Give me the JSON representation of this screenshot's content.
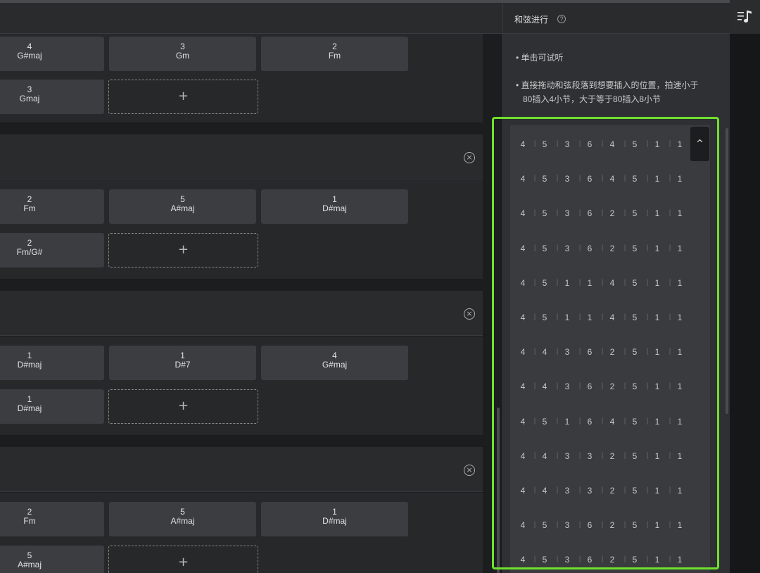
{
  "sections": [
    {
      "chords_row1": [
        {
          "degree": "4",
          "name": "G#maj"
        },
        {
          "degree": "3",
          "name": "Gm"
        },
        {
          "degree": "2",
          "name": "Fm"
        }
      ],
      "chords_row2": [
        {
          "degree": "3",
          "name": "Gmaj"
        }
      ],
      "add_label": "+"
    },
    {
      "close_symbol": "×",
      "chords_row1": [
        {
          "degree": "2",
          "name": "Fm"
        },
        {
          "degree": "5",
          "name": "A#maj"
        },
        {
          "degree": "1",
          "name": "D#maj"
        }
      ],
      "chords_row2": [
        {
          "degree": "2",
          "name": "Fm/G#"
        }
      ],
      "add_label": "+"
    },
    {
      "close_symbol": "×",
      "chords_row1": [
        {
          "degree": "1",
          "name": "D#maj"
        },
        {
          "degree": "1",
          "name": "D#7"
        },
        {
          "degree": "4",
          "name": "G#maj"
        }
      ],
      "chords_row2": [
        {
          "degree": "1",
          "name": "D#maj"
        }
      ],
      "add_label": "+"
    },
    {
      "close_symbol": "×",
      "chords_row1": [
        {
          "degree": "2",
          "name": "Fm"
        },
        {
          "degree": "5",
          "name": "A#maj"
        },
        {
          "degree": "1",
          "name": "D#maj"
        }
      ],
      "chords_row2": [
        {
          "degree": "5",
          "name": "A#maj"
        }
      ],
      "add_label": "+"
    }
  ],
  "panel": {
    "title": "和弦进行",
    "help_symbol": "?",
    "tip_bullet": "•",
    "tip1": "单击可试听",
    "tip2_line1": "直接拖动和弦段落到想要插入的位置，拍速小于",
    "tip2_line2": "80插入4小节，大于等于80插入8小节",
    "collapse_symbol": "^",
    "progressions": [
      [
        "4",
        "5",
        "3",
        "6",
        "4",
        "5",
        "1",
        "1"
      ],
      [
        "4",
        "5",
        "3",
        "6",
        "4",
        "5",
        "1",
        "1"
      ],
      [
        "4",
        "5",
        "3",
        "6",
        "2",
        "5",
        "1",
        "1"
      ],
      [
        "4",
        "5",
        "3",
        "6",
        "2",
        "5",
        "1",
        "1"
      ],
      [
        "4",
        "5",
        "1",
        "1",
        "4",
        "5",
        "1",
        "1"
      ],
      [
        "4",
        "5",
        "1",
        "1",
        "4",
        "5",
        "1",
        "1"
      ],
      [
        "4",
        "4",
        "3",
        "6",
        "2",
        "5",
        "1",
        "1"
      ],
      [
        "4",
        "4",
        "3",
        "6",
        "2",
        "5",
        "1",
        "1"
      ],
      [
        "4",
        "5",
        "1",
        "6",
        "4",
        "5",
        "1",
        "1"
      ],
      [
        "4",
        "4",
        "3",
        "3",
        "2",
        "5",
        "1",
        "1"
      ],
      [
        "4",
        "4",
        "3",
        "3",
        "2",
        "5",
        "1",
        "1"
      ],
      [
        "4",
        "5",
        "3",
        "6",
        "2",
        "5",
        "1",
        "1"
      ],
      [
        "4",
        "5",
        "3",
        "6",
        "2",
        "5",
        "1",
        "1"
      ]
    ],
    "separator": "|"
  },
  "colors": {
    "highlight": "#6ee02c",
    "chord_bg": "#3c3d40",
    "background": "#1c1d1f"
  },
  "rail": {
    "icon": "playlist-music-icon"
  }
}
